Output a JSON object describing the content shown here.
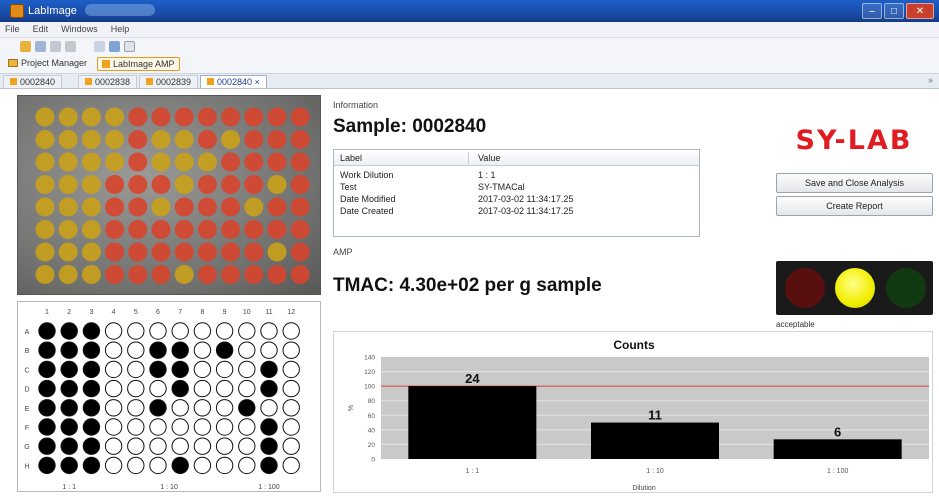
{
  "window": {
    "title": "LabImage",
    "menu": [
      "File",
      "Edit",
      "Windows",
      "Help"
    ]
  },
  "toolbar": {
    "project_manager_label": "Project Manager",
    "amp_button_label": "LabImage AMP"
  },
  "tabs": [
    {
      "label": "0002840",
      "active": false
    },
    {
      "label": "0002838",
      "active": false
    },
    {
      "label": "0002839",
      "active": false
    },
    {
      "label": "0002840",
      "active": true
    }
  ],
  "plate": {
    "columns": [
      "1",
      "2",
      "3",
      "4",
      "5",
      "6",
      "7",
      "8",
      "9",
      "10",
      "11",
      "12"
    ],
    "rows": [
      "A",
      "B",
      "C",
      "D",
      "E",
      "F",
      "G",
      "H"
    ],
    "filled": [
      [
        1,
        1,
        1,
        0,
        0,
        0,
        0,
        0,
        0,
        0,
        0,
        0
      ],
      [
        1,
        1,
        1,
        0,
        0,
        1,
        1,
        0,
        1,
        0,
        0,
        0
      ],
      [
        1,
        1,
        1,
        0,
        0,
        1,
        1,
        0,
        0,
        0,
        1,
        0
      ],
      [
        1,
        1,
        1,
        0,
        0,
        0,
        1,
        0,
        0,
        0,
        1,
        0
      ],
      [
        1,
        1,
        1,
        0,
        0,
        1,
        0,
        0,
        0,
        1,
        0,
        0
      ],
      [
        1,
        1,
        1,
        0,
        0,
        0,
        0,
        0,
        0,
        0,
        1,
        0
      ],
      [
        1,
        1,
        1,
        0,
        0,
        0,
        0,
        0,
        0,
        0,
        1,
        0
      ],
      [
        1,
        1,
        1,
        0,
        0,
        0,
        1,
        0,
        0,
        0,
        1,
        0
      ]
    ],
    "dilution_labels": [
      "1 : 1",
      "1 : 10",
      "1 : 100"
    ],
    "photo_wells": [
      [
        "y",
        "y",
        "y",
        "y",
        "r",
        "r",
        "r",
        "r",
        "r",
        "r",
        "r",
        "r"
      ],
      [
        "y",
        "y",
        "y",
        "y",
        "r",
        "y",
        "y",
        "r",
        "y",
        "r",
        "r",
        "r"
      ],
      [
        "y",
        "y",
        "y",
        "y",
        "r",
        "y",
        "y",
        "y",
        "r",
        "r",
        "r",
        "r"
      ],
      [
        "y",
        "y",
        "y",
        "r",
        "r",
        "r",
        "y",
        "r",
        "r",
        "r",
        "y",
        "r"
      ],
      [
        "y",
        "y",
        "y",
        "r",
        "r",
        "y",
        "r",
        "r",
        "r",
        "y",
        "r",
        "r"
      ],
      [
        "y",
        "y",
        "y",
        "r",
        "r",
        "r",
        "r",
        "r",
        "r",
        "r",
        "r",
        "r"
      ],
      [
        "y",
        "y",
        "y",
        "r",
        "r",
        "r",
        "r",
        "r",
        "r",
        "r",
        "y",
        "r"
      ],
      [
        "y",
        "y",
        "y",
        "r",
        "r",
        "r",
        "y",
        "r",
        "r",
        "r",
        "r",
        "r"
      ]
    ],
    "well_colors": {
      "y": "#c9a11a",
      "r": "#d8452c"
    }
  },
  "information": {
    "heading": "Information",
    "sample_title": "Sample: 0002840",
    "table_headers": [
      "Label",
      "Value"
    ],
    "rows": [
      {
        "label": "Work Dilution",
        "value": "1 : 1"
      },
      {
        "label": "Test",
        "value": "SY-TMACal"
      },
      {
        "label": "Date Modified",
        "value": "2017-03-02 11:34:17.25"
      },
      {
        "label": "Date Created",
        "value": "2017-03-02 11:34:17.25"
      }
    ]
  },
  "logo_text": "SY-LAB",
  "actions": {
    "save_close": "Save and Close Analysis",
    "create_report": "Create Report"
  },
  "amp": {
    "heading": "AMP",
    "result": "TMAC:  4.30e+02 per g sample"
  },
  "traffic_light": {
    "state": "yellow",
    "status": "acceptable"
  },
  "colors": {
    "accent": "#f0a21e",
    "logo": "#e11b22",
    "chart_bg": "#c9c9c9",
    "bar": "#000000",
    "threshold_line": "#d43a3a"
  },
  "chart_data": {
    "type": "bar",
    "title": "Counts",
    "categories": [
      "1 : 1",
      "1 : 10",
      "1 : 100"
    ],
    "values": [
      24,
      11,
      6
    ],
    "bar_heights": [
      100,
      50,
      27
    ],
    "xlabel": "Dilution",
    "ylabel": "%",
    "ylim": [
      0,
      140
    ],
    "yticks": [
      0,
      20,
      40,
      60,
      80,
      100,
      120,
      140
    ],
    "threshold": 100,
    "grid": true
  }
}
